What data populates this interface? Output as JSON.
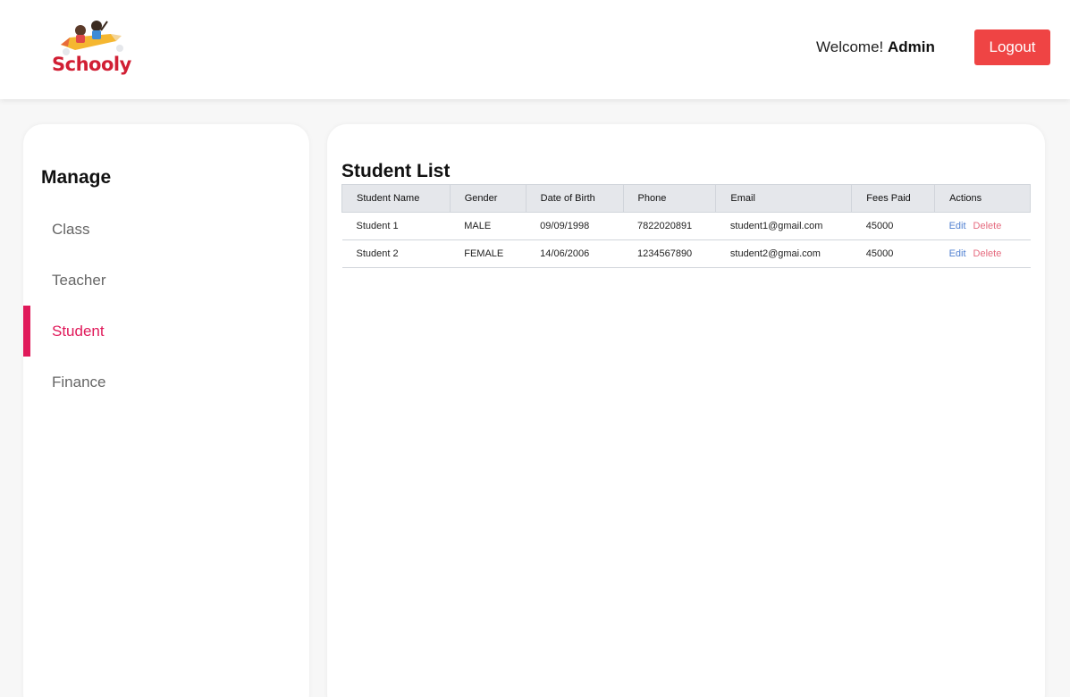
{
  "header": {
    "logo_text": "Schooly",
    "welcome_prefix": "Welcome!",
    "user_name": "Admin",
    "logout_label": "Logout"
  },
  "sidebar": {
    "title": "Manage",
    "items": [
      {
        "label": "Class"
      },
      {
        "label": "Teacher"
      },
      {
        "label": "Student"
      },
      {
        "label": "Finance"
      }
    ],
    "active_item": "Student"
  },
  "main": {
    "title": "Student List",
    "columns": [
      "Student Name",
      "Gender",
      "Date of Birth",
      "Phone",
      "Email",
      "Fees Paid",
      "Actions"
    ],
    "rows": [
      {
        "name": "Student 1",
        "gender": "MALE",
        "dob": "09/09/1998",
        "phone": "7822020891",
        "email": "student1@gmail.com",
        "fees": "45000",
        "edit": "Edit",
        "delete": "Delete"
      },
      {
        "name": "Student 2",
        "gender": "FEMALE",
        "dob": "14/06/2006",
        "phone": "1234567890",
        "email": "student2@gmai.com",
        "fees": "45000",
        "edit": "Edit",
        "delete": "Delete"
      }
    ]
  },
  "colors": {
    "accent": "#e0195a",
    "logout_bg": "#ef4444",
    "logo_red": "#d11f34",
    "edit_link": "#4f7fd0",
    "delete_link": "#e56a7e"
  }
}
